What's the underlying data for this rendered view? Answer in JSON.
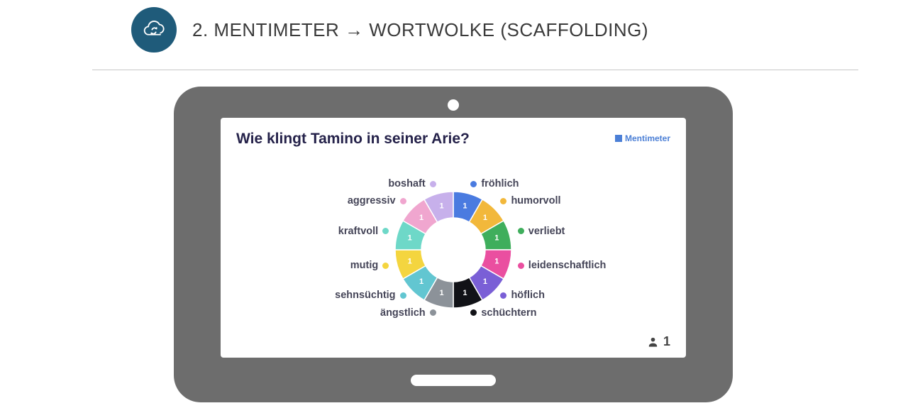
{
  "header": {
    "title": "2. MENTIMETER → WORTWOLKE (SCAFFOLDING)"
  },
  "slide": {
    "title": "Wie klingt Tamino in seiner Arie?",
    "brand": "Mentimeter",
    "participants": "1"
  },
  "chart_data": {
    "type": "pie",
    "title": "Wie klingt Tamino in seiner Arie?",
    "series": [
      {
        "name": "fröhlich",
        "value": 1,
        "color": "#4a7be0"
      },
      {
        "name": "humorvoll",
        "value": 1,
        "color": "#f2b83b"
      },
      {
        "name": "verliebt",
        "value": 1,
        "color": "#3fae5c"
      },
      {
        "name": "leidenschaftlich",
        "value": 1,
        "color": "#ea4fa0"
      },
      {
        "name": "höflich",
        "value": 1,
        "color": "#7a5fd6"
      },
      {
        "name": "schüchtern",
        "value": 1,
        "color": "#111217"
      },
      {
        "name": "ängstlich",
        "value": 1,
        "color": "#8c9299"
      },
      {
        "name": "sehnsüchtig",
        "value": 1,
        "color": "#62c6d1"
      },
      {
        "name": "mutig",
        "value": 1,
        "color": "#f4d53f"
      },
      {
        "name": "kraftvoll",
        "value": 1,
        "color": "#6ed8c8"
      },
      {
        "name": "aggressiv",
        "value": 1,
        "color": "#f0a6cf"
      },
      {
        "name": "boshaft",
        "value": 1,
        "color": "#c7b0eb"
      }
    ]
  }
}
